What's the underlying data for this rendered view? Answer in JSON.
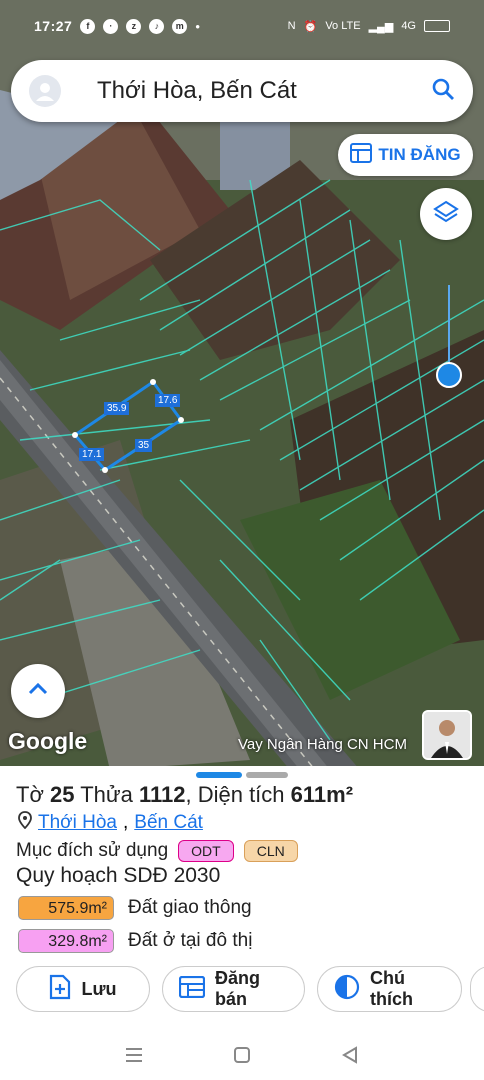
{
  "status_bar": {
    "time": "17:27",
    "net": "4G",
    "volte": "Vo LTE"
  },
  "search": {
    "query": "Thới Hòa, Bến Cát"
  },
  "map": {
    "post_button_label": "TIN ĐĂNG",
    "google_logo": "Google",
    "ad_text": "Vay Ngân Hàng CN HCM",
    "dimensions": [
      "35.9",
      "17.6",
      "35",
      "17.1"
    ]
  },
  "sheet": {
    "title_prefix": "Tờ",
    "sheet_no": "25",
    "plot_word": "Thửa",
    "plot_no": "1112",
    "area_word": ", Diện tích",
    "area_value": "611m²",
    "ward": "Thới Hòa",
    "separator": ",",
    "district": "Bến Cát",
    "purpose_label": "Mục đích sử dụng",
    "purpose_chips": [
      {
        "label": "ODT",
        "color": "#f7a8f0"
      },
      {
        "label": "CLN",
        "color": "#f7d6a8"
      }
    ],
    "plan_label": "Quy hoạch SDĐ 2030",
    "plan_rows": [
      {
        "area": "575.9m²",
        "label": "Đất giao thông",
        "color": "#f7a540"
      },
      {
        "area": "329.8m²",
        "label": "Đất ở tại đô thị",
        "color": "#f7a0f2"
      }
    ],
    "actions": [
      {
        "label": "Lưu",
        "icon": "add-file-icon"
      },
      {
        "label": "Đăng bán",
        "icon": "list-board-icon"
      },
      {
        "label": "Chú thích",
        "icon": "half-circle-icon"
      }
    ]
  }
}
